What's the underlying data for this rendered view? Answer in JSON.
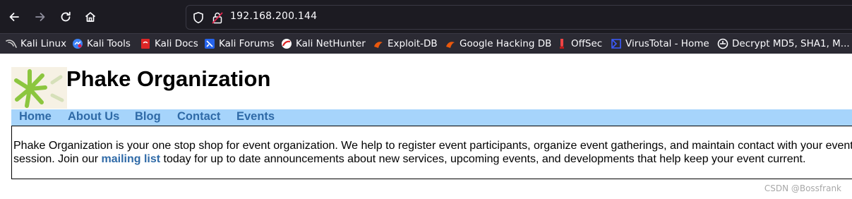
{
  "browser": {
    "url": "192.168.200.144",
    "bookmarks": [
      {
        "label": "Kali Linux",
        "icon": "kali-dragon-icon"
      },
      {
        "label": "Kali Tools",
        "icon": "kali-tools-icon"
      },
      {
        "label": "Kali Docs",
        "icon": "kali-docs-icon"
      },
      {
        "label": "Kali Forums",
        "icon": "kali-forums-icon"
      },
      {
        "label": "Kali NetHunter",
        "icon": "nethunter-icon"
      },
      {
        "label": "Exploit-DB",
        "icon": "exploit-db-icon"
      },
      {
        "label": "Google Hacking DB",
        "icon": "ghdb-icon"
      },
      {
        "label": "OffSec",
        "icon": "offsec-icon"
      },
      {
        "label": "VirusTotal - Home",
        "icon": "virustotal-icon"
      },
      {
        "label": "Decrypt MD5, SHA1, M...",
        "icon": "decrypt-icon"
      }
    ]
  },
  "site": {
    "title": "Phake Organization",
    "menu": [
      "Home",
      "About Us",
      "Blog",
      "Contact",
      "Events"
    ],
    "intro_line1": "Phake Organization is your one stop shop for event organization. We help to register event participants, organize event gatherings, and maintain contact with your event",
    "intro_line2_prefix": "session. Join our ",
    "intro_link": "mailing list",
    "intro_line2_suffix": " today for up to date announcements about new services, upcoming events, and developments that help keep your event current."
  },
  "watermark": "CSDN @Bossfrank",
  "colors": {
    "toolbar_bg": "#1c1b22",
    "bookmarks_bg": "#2b2a33",
    "menu_bg": "#a6d4fb",
    "link": "#2f6aa7",
    "logo_green": "#8cc63f"
  }
}
